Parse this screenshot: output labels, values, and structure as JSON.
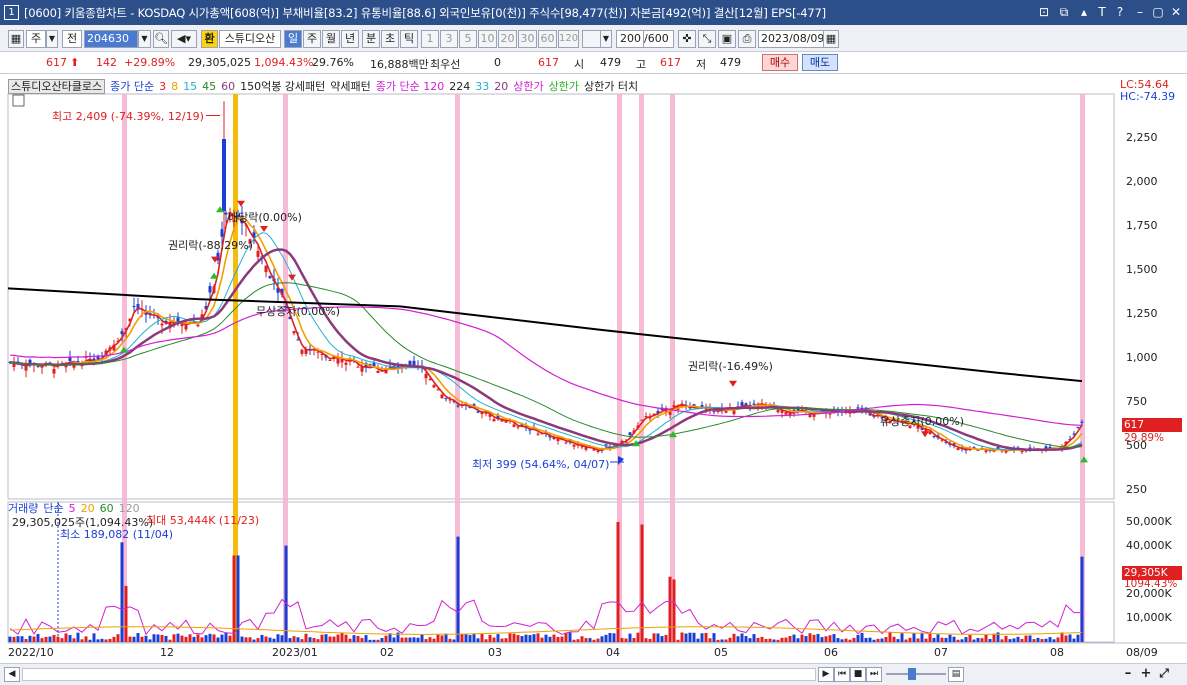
{
  "titlebar": {
    "window_num": "1",
    "title": "[0600] 키움종합차트 - KOSDAQ 시가총액[608(억)] 부채비율[83.2] 유통비율[88.6] 외국인보유[0(천)] 주식수[98,477(천)] 자본금[492(억)] 결산[12월] EPS[-477]",
    "controls": [
      "⊡",
      "⧉",
      "▴",
      "T",
      "?",
      "–",
      "▢",
      "✕"
    ]
  },
  "toolbar": {
    "period_week": "주",
    "market": "전",
    "code": "204630",
    "stock_name": "스튜디오산",
    "currency_icon": "환",
    "periods": [
      "일",
      "주",
      "월",
      "년",
      "분",
      "초",
      "틱"
    ],
    "minute_options": [
      "1",
      "3",
      "5",
      "10",
      "20",
      "30",
      "60",
      "120"
    ],
    "count_value": "200",
    "count_total": "/600",
    "date": "2023/08/09"
  },
  "inforow": {
    "price": "617",
    "change": "142",
    "change_pct": "+29.89%",
    "volume": "29,305,025",
    "vol_pct": "1,094.43%",
    "turnover": "29.76%",
    "trade_amount": "16,888백만",
    "preferred_label": "최우선",
    "preferred_val": "0",
    "preferred_price": "617",
    "open_label": "시",
    "open": "479",
    "high_label": "고",
    "high": "617",
    "low_label": "저",
    "low": "479",
    "buy_label": "매수",
    "sell_label": "매도"
  },
  "indicators": {
    "name": "스튜디오산타클로스",
    "ma_label": "종가 단순",
    "ma_periods": [
      "3",
      "8",
      "15",
      "45",
      "60"
    ],
    "pattern1": "150억봉 강세패턴",
    "pattern2": "약세패턴",
    "ma120_label": "종가 단순 120",
    "extra_periods": [
      "224",
      "33",
      "20"
    ],
    "upper_limit": "상한가",
    "upper_limit2": "상한가",
    "upper_touch": "상한가 터치"
  },
  "lc_hc": {
    "lc": "LC:54.64",
    "hc": "HC:-74.39"
  },
  "annotations": {
    "high": "최고 2,409 (-74.39%, 12/19)",
    "low": "최저 399 (54.64%, 04/07)",
    "rights1": "권리락(-88.29%)",
    "split": "배당락(0.00%)",
    "free_inc1": "무상증자(0.00%)",
    "rights2": "권리락(-16.49%)",
    "paid_inc": "유상증자(0.00%)"
  },
  "price_axis": [
    "2,250",
    "2,000",
    "1,750",
    "1,500",
    "1,250",
    "1,000",
    "750",
    "500",
    "250"
  ],
  "price_tag": {
    "price": "617",
    "pct": "29.89%"
  },
  "volume_legend": {
    "label": "거래량",
    "ma_label": "단순",
    "periods": [
      "5",
      "20",
      "60",
      "120"
    ],
    "current": "29,305,025주(1,094.43%)",
    "max": "최대 53,444K (11/23)",
    "min": "최소 189,082 (11/04)"
  },
  "volume_axis": [
    "50,000K",
    "40,000K",
    "30,000K",
    "20,000K",
    "10,000K"
  ],
  "volume_tag": {
    "vol": "29,305K",
    "pct": "1094.43%"
  },
  "time_axis": [
    "2022/10",
    "12",
    "2023/01",
    "02",
    "03",
    "04",
    "05",
    "06",
    "07",
    "08",
    "08/09"
  ],
  "colors": {
    "up": "#e02020",
    "down": "#1a3fd6",
    "ma3": "#e02020",
    "ma8": "#f0a000",
    "ma15": "#20b0d0",
    "ma45": "#8a3a7a",
    "ma60": "#2a8a2a",
    "ma120": "#d020d0",
    "ma224": "#000000",
    "event_band": "#f7b4d0",
    "limit_band": "#f5b800"
  },
  "chart_data": {
    "type": "candlestick",
    "price_range": [
      200,
      2450
    ],
    "volume_range_K": [
      0,
      55000
    ]
  }
}
